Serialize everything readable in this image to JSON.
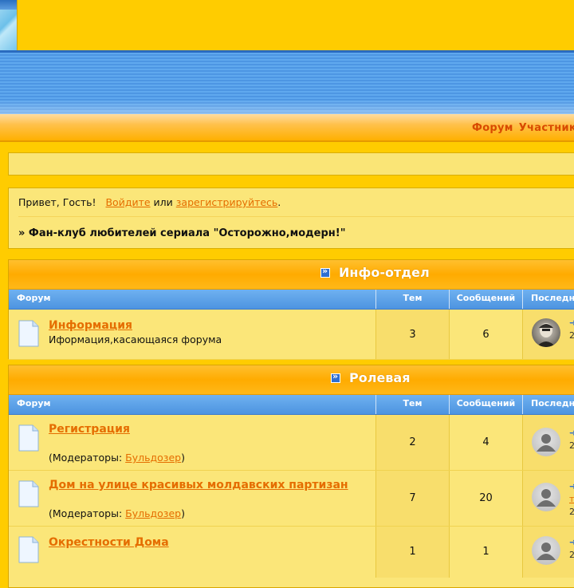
{
  "nav": {
    "links": [
      "Форум",
      "Участники"
    ]
  },
  "welcome": {
    "greeting": "Привет, Гость!",
    "login": "Войдите",
    "or": "или",
    "register": "зарегистрируйтесь",
    "dot": ".",
    "breadcrumb": "» Фан-клуб любителей сериала \"Осторожно,модерн!\""
  },
  "columns": {
    "forum": "Форум",
    "topics": "Тем",
    "messages": "Сообщений",
    "last": "Последнее"
  },
  "categories": [
    {
      "title": "Инфо-отдел",
      "forums": [
        {
          "name": "Информация",
          "description": "Иформация,касающаяся форума",
          "topics": "3",
          "messages": "6",
          "last_line1": "➜",
          "last_line2": "2"
        }
      ]
    },
    {
      "title": "Ролевая",
      "forums": [
        {
          "name": "Регистрация",
          "moderators_label": "(Модераторы:",
          "moderator": "Бульдозер",
          "moderators_close": ")",
          "topics": "2",
          "messages": "4",
          "last_line1": "➜",
          "last_line2": "2"
        },
        {
          "name": "Дом на улице красивых молдавских партизан",
          "moderators_label": "(Модераторы:",
          "moderator": "Бульдозер",
          "moderators_close": ")",
          "topics": "7",
          "messages": "20",
          "last_line1": "➜",
          "last_line2": "т",
          "last_line3": "2"
        },
        {
          "name": "Окрестности Дома",
          "topics": "1",
          "messages": "1",
          "last_line1": "➜",
          "last_line2": "2"
        }
      ]
    }
  ]
}
